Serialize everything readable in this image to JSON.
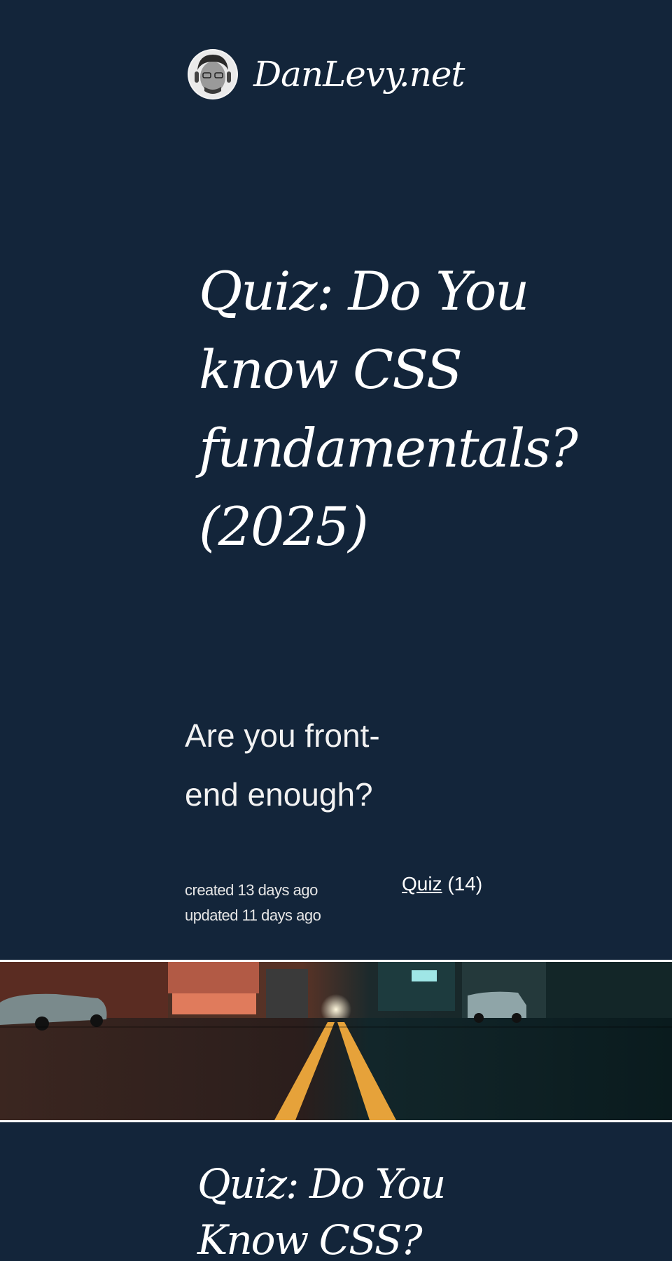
{
  "header": {
    "site_name": "DanLevy.net",
    "avatar_icon": "author-avatar-icon"
  },
  "post": {
    "title": "Quiz: Do You know CSS fundamentals? (2025)",
    "subtitle": "Are you front-end enough?",
    "created": "created 13 days ago",
    "updated": "updated 11 days ago",
    "tag_label": "Quiz",
    "tag_count": "(14)"
  },
  "banner": {
    "image_icon": "city-street-night-photo"
  },
  "next_post": {
    "title": "Quiz: Do You Know CSS?"
  },
  "colors": {
    "background": "#13253a",
    "text": "#ffffff"
  }
}
